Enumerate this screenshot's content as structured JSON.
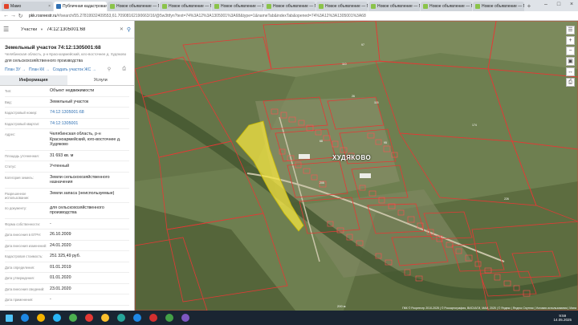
{
  "browser": {
    "tabs": [
      {
        "label": "Мамо",
        "color": "#e24329"
      },
      {
        "label": "Публичная кадастровая ка",
        "color": "#2f70b3",
        "active": true
      },
      {
        "label": "Новое объявление — Про",
        "color": "#8bc34a"
      },
      {
        "label": "Новое объявление — Про",
        "color": "#8bc34a"
      },
      {
        "label": "Новое объявление — Про",
        "color": "#8bc34a"
      },
      {
        "label": "Новое объявление — Про",
        "color": "#8bc34a"
      },
      {
        "label": "Новое объявление — Про",
        "color": "#8bc34a"
      },
      {
        "label": "Новое объявление — Про",
        "color": "#8bc34a"
      },
      {
        "label": "Новое объявление — Про",
        "color": "#8bc34a"
      },
      {
        "label": "Новое объявление — Про",
        "color": "#8bc34a"
      }
    ],
    "url_domain": "pkk.rosreestr.ru",
    "url_rest": "/#/search/55.27819932409553,61.70908162190663/16/@5w3ttfyn?text=74%3A12%3A1305001%3A68&type=1&nameTab&indexTab&opened=74%3A12%3A1305001%3A68"
  },
  "panel": {
    "search_type": "Участки",
    "search_value": "74:12:1305001:68",
    "title": "Земельный участок 74:12:1305001:68",
    "address_short": "Челябинская область, р-н Красноармейский, юго-восточнее д. Худяково",
    "purpose": "для сельскохозяйственного производства",
    "links": [
      "План ЗУ →",
      "План КК →",
      "Создать участок ЖС →"
    ],
    "tabs": [
      "Информация",
      "Услуги"
    ],
    "rows": [
      {
        "k": "Тип:",
        "v": "Объект недвижимости"
      },
      {
        "k": "Вид:",
        "v": "Земельный участок"
      },
      {
        "k": "Кадастровый номер:",
        "v": "74:12:1305001:68",
        "link": true
      },
      {
        "k": "Кадастровый квартал:",
        "v": "74:12:1305001",
        "link": true
      },
      {
        "k": "Адрес:",
        "v": "Челябинская область, р-н Красноармейский, юго-восточнее д. Худяково"
      },
      {
        "k": "Площадь уточненная:",
        "v": "31 693 кв. м"
      },
      {
        "k": "Статус:",
        "v": "Учтенный"
      },
      {
        "k": "Категория земель:",
        "v": "Земли сельскохозяйственного назначения"
      },
      {
        "k": "Разрешенное использование:",
        "v": "Земли запаса (неиспользуемые)"
      },
      {
        "k": "по документу:",
        "v": "для сельскохозяйственного производства"
      },
      {
        "k": "Форма собственности:",
        "v": "-"
      },
      {
        "k": "Дата внесения в ЕГРН:",
        "v": "26.10.2009"
      },
      {
        "k": "Дата внесения изменений:",
        "v": "24.01.2020"
      },
      {
        "k": "Кадастровая стоимость:",
        "v": "251 325,49 руб."
      },
      {
        "k": "Дата определения:",
        "v": "01.01.2019"
      },
      {
        "k": "Дата утверждения:",
        "v": "01.01.2020"
      },
      {
        "k": "Дата внесения сведений:",
        "v": "23.01.2020"
      },
      {
        "k": "Дата применения:",
        "v": "-"
      }
    ]
  },
  "map": {
    "village_label": "ХУДЯКОВО",
    "scale_label": "200 м",
    "attribution": "ПКК © Росреестр 2010-2025 | © Роскартография, ВИСХАГИ, МАИ, 2025 | © Яндекс | Яндекс Спутник | Условия использования | Мапа",
    "parcel_numbers": [
      "110",
      "97",
      "26",
      "68",
      "95",
      "115",
      "174",
      "205",
      "226"
    ]
  },
  "taskbar": {
    "time": "9:59",
    "date": "14.05.2025",
    "apps": [
      "#1e88e5",
      "#f4b400",
      "#29b6f6",
      "#4caf50",
      "#e53935",
      "#fbc02d",
      "#26a69a",
      "#1e88e5",
      "#d32f2f",
      "#43a047",
      "#7e57c2"
    ]
  }
}
